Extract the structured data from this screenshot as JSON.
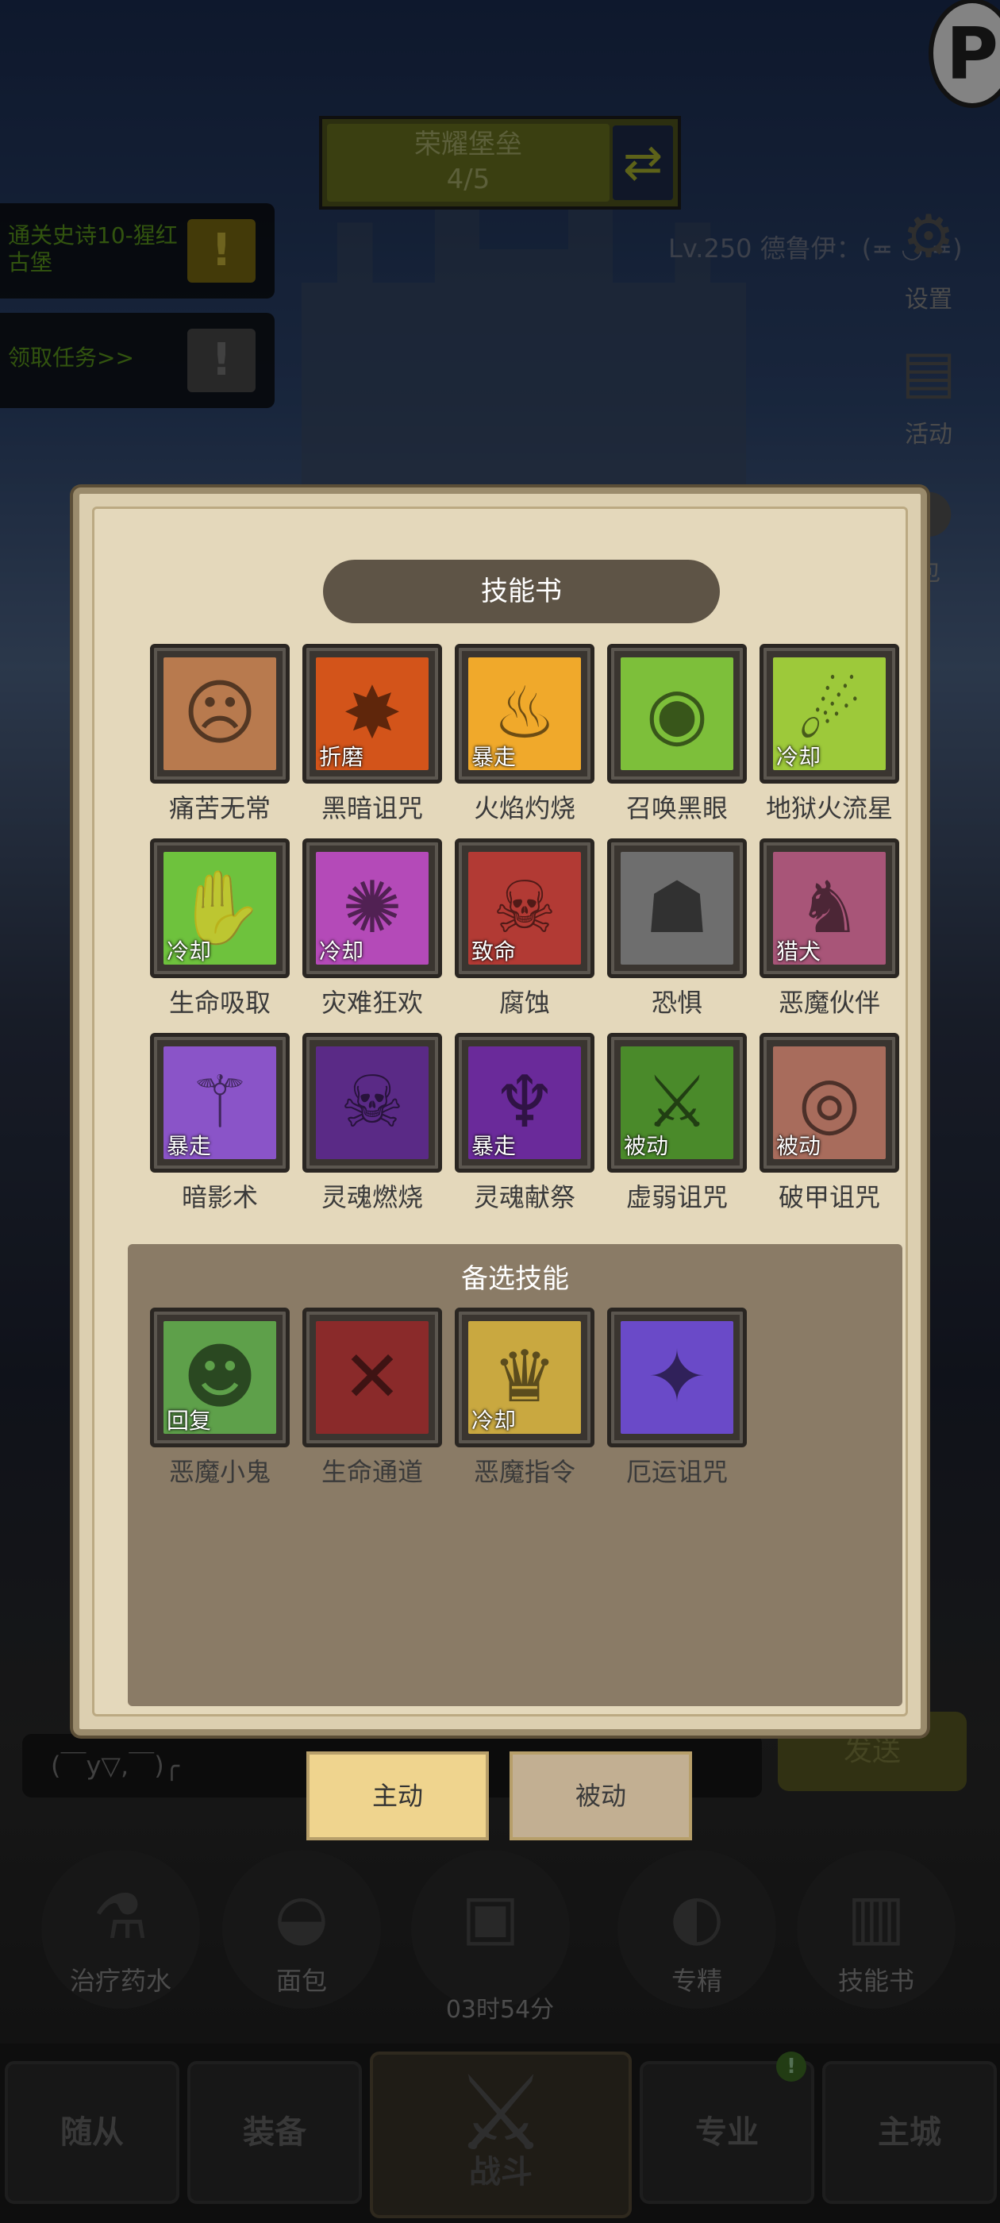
{
  "fortress": {
    "name": "荣耀堡垒",
    "progress": "4/5",
    "icon": "swap-arrows-icon",
    "fill_fraction": 0.8
  },
  "quests": [
    {
      "text": "通关史诗10-猩红古堡",
      "badge": "!",
      "icon": "exclamation-icon"
    },
    {
      "text": "领取任务>>",
      "badge": "!",
      "icon": "exclamation-icon"
    }
  ],
  "player": {
    "label": "Lv.250 德鲁伊：(≖ ◡ ≖)"
  },
  "side_buttons": [
    {
      "label": "设置",
      "icon": "gear-icon"
    },
    {
      "label": "活动",
      "icon": "scroll-icon"
    },
    {
      "label": "包",
      "icon": "bag-icon"
    }
  ],
  "corner_badge": "P",
  "dialog": {
    "title": "技能书",
    "backup_title": "备选技能",
    "skills": [
      {
        "name": "痛苦无常",
        "tag": "",
        "color": "#b87a4e",
        "glyph": "☹"
      },
      {
        "name": "黑暗诅咒",
        "tag": "折磨",
        "color": "#d3541a",
        "glyph": "✸"
      },
      {
        "name": "火焰灼烧",
        "tag": "暴走",
        "color": "#f0a92b",
        "glyph": "♨"
      },
      {
        "name": "召唤黑眼",
        "tag": "",
        "color": "#7dbf3a",
        "glyph": "◉"
      },
      {
        "name": "地狱火流星",
        "tag": "冷却",
        "color": "#9dc93a",
        "glyph": "☄"
      },
      {
        "name": "生命吸取",
        "tag": "冷却",
        "color": "#6ec23d",
        "glyph": "✋"
      },
      {
        "name": "灾难狂欢",
        "tag": "冷却",
        "color": "#b44ab8",
        "glyph": "✺"
      },
      {
        "name": "腐蚀",
        "tag": "致命",
        "color": "#b23a34",
        "glyph": "☠"
      },
      {
        "name": "恐惧",
        "tag": "",
        "color": "#6e6e6e",
        "glyph": "☗"
      },
      {
        "name": "恶魔伙伴",
        "tag": "猎犬",
        "color": "#a85578",
        "glyph": "♞"
      },
      {
        "name": "暗影术",
        "tag": "暴走",
        "color": "#8a54c8",
        "glyph": "⚚"
      },
      {
        "name": "灵魂燃烧",
        "tag": "",
        "color": "#5a2a86",
        "glyph": "☠"
      },
      {
        "name": "灵魂献祭",
        "tag": "暴走",
        "color": "#6a2a9a",
        "glyph": "♆"
      },
      {
        "name": "虚弱诅咒",
        "tag": "被动",
        "color": "#4a8a2a",
        "glyph": "⚔"
      },
      {
        "name": "破甲诅咒",
        "tag": "被动",
        "color": "#a86c5c",
        "glyph": "◎"
      }
    ],
    "backup_skills": [
      {
        "name": "恶魔小鬼",
        "tag": "回复",
        "color": "#5ea04a",
        "glyph": "☻"
      },
      {
        "name": "生命通道",
        "tag": "",
        "color": "#8a2a2a",
        "glyph": "✕"
      },
      {
        "name": "恶魔指令",
        "tag": "冷却",
        "color": "#c9a840",
        "glyph": "♛"
      },
      {
        "name": "厄运诅咒",
        "tag": "",
        "color": "#6a4ac8",
        "glyph": "✦"
      }
    ]
  },
  "tabs": {
    "active": "主动",
    "inactive": "被动"
  },
  "chat": {
    "placeholder": "(￣y▽,￣)╭",
    "send": "发送"
  },
  "hud": [
    {
      "label": "治疗药水",
      "icon": "potion-icon"
    },
    {
      "label": "面包",
      "icon": "bread-icon"
    },
    {
      "label": "",
      "icon": "treasure-chest-icon"
    },
    {
      "label": "专精",
      "icon": "specialization-icon"
    },
    {
      "label": "技能书",
      "icon": "book-icon"
    }
  ],
  "timer": "03时54分",
  "nav": {
    "items": [
      "随从",
      "装备",
      "战斗",
      "专业",
      "主城"
    ],
    "badge": "!"
  }
}
